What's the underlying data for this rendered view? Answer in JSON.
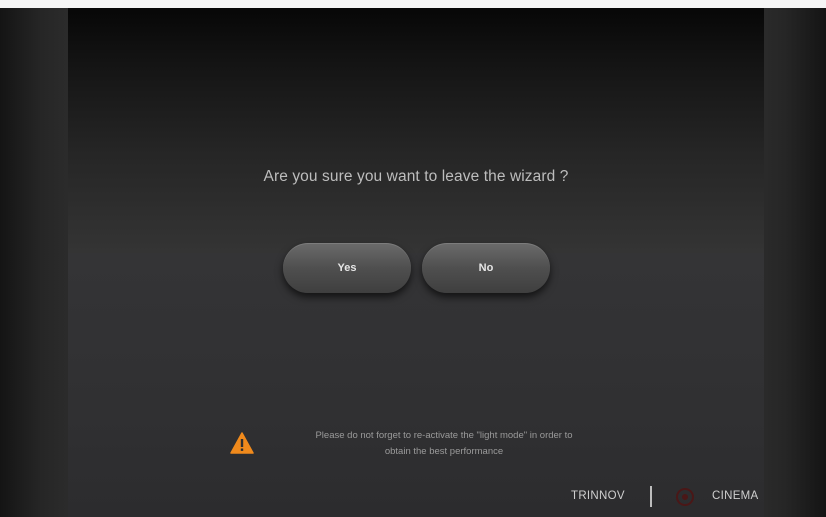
{
  "dialog": {
    "question": "Are you sure you want to leave the wizard ?",
    "yes_label": "Yes",
    "no_label": "No"
  },
  "warning": {
    "icon": "warning-triangle-icon",
    "line1": "Please do not forget to re-activate the \"light mode\" in order to",
    "line2": "obtain the best performance"
  },
  "footer": {
    "brand_left": "TRINNOV",
    "brand_right": "CINEMA",
    "logo_icon": "cinema-logo-icon"
  },
  "colors": {
    "warning": "#f08a1c",
    "logo": "#5a1a1a"
  }
}
